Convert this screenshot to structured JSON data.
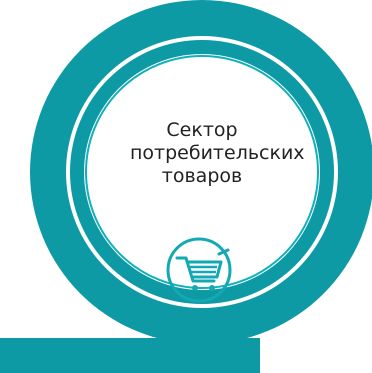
{
  "card": {
    "label_lines": [
      "Сектор",
      "потребительских",
      "товаров"
    ],
    "icon": "shopping-cart-icon",
    "colors": {
      "ring": "#0e9aa5",
      "inner_ring": "#12b0bc",
      "inner_fill": "#ffffff",
      "text": "#222222"
    }
  }
}
